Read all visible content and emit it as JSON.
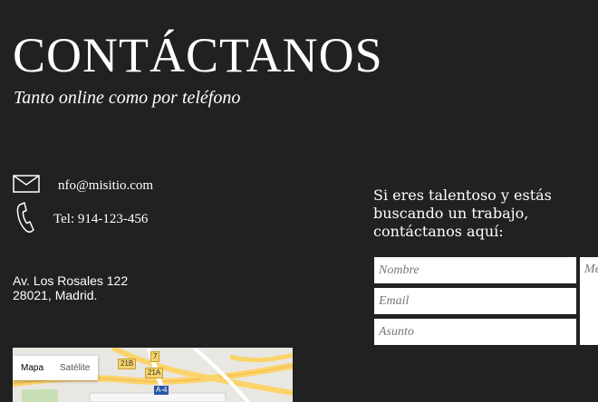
{
  "header": {
    "title": "CONTÁCTANOS",
    "subtitle": "Tanto online como por teléfono"
  },
  "contact": {
    "email": "nfo@misitio.com",
    "email_icon": "envelope-icon",
    "phone": "Tel: 914-123-456",
    "phone_icon": "phone-icon"
  },
  "address": {
    "line1": "Av. Los Rosales 122",
    "line2": "28021, Madrid."
  },
  "map": {
    "type_options": [
      "Mapa",
      "Satélite"
    ],
    "selected_type": "Mapa",
    "road_labels": [
      "21B",
      "7",
      "21A"
    ],
    "highway_label": "A-4"
  },
  "form": {
    "intro": "Si eres talentoso y estás buscando un trabajo, contáctanos aquí:",
    "name_placeholder": "Nombre",
    "email_placeholder": "Email",
    "subject_placeholder": "Asunto",
    "message_placeholder": "Me"
  },
  "colors": {
    "background": "#212121",
    "text": "#ffffff",
    "field_background": "#ffffff"
  }
}
